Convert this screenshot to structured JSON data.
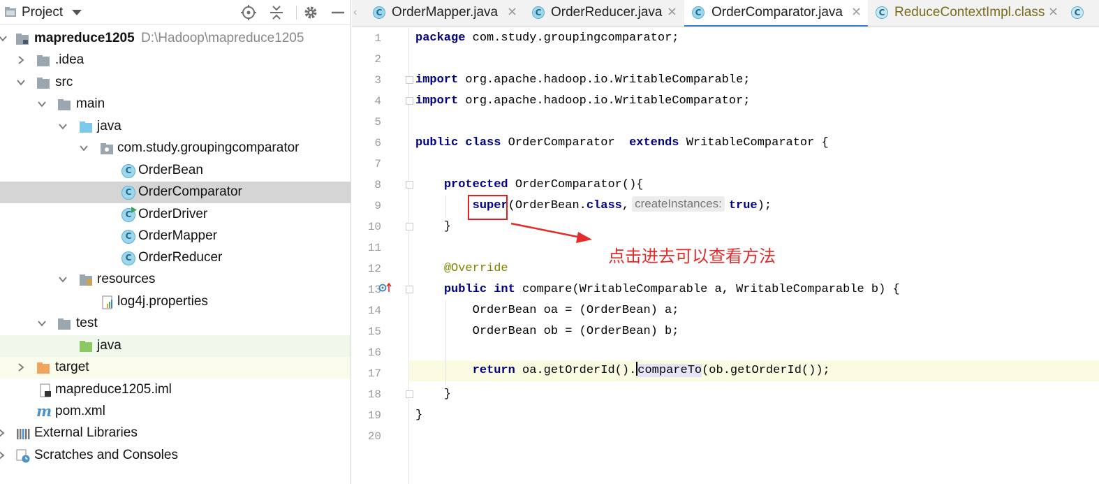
{
  "project_panel": {
    "title": "Project",
    "tree": [
      {
        "label": "mapreduce1205",
        "path": "D:\\Hadoop\\mapreduce1205",
        "icon": "module-folder-icon"
      },
      {
        "label": ".idea",
        "icon": "folder-icon"
      },
      {
        "label": "src",
        "icon": "folder-icon"
      },
      {
        "label": "main",
        "icon": "folder-icon"
      },
      {
        "label": "java",
        "icon": "source-folder-icon"
      },
      {
        "label": "com.study.groupingcomparator",
        "icon": "package-icon"
      },
      {
        "label": "OrderBean",
        "icon": "class-icon"
      },
      {
        "label": "OrderComparator",
        "icon": "class-icon"
      },
      {
        "label": "OrderDriver",
        "icon": "runnable-class-icon"
      },
      {
        "label": "OrderMapper",
        "icon": "class-icon"
      },
      {
        "label": "OrderReducer",
        "icon": "class-icon"
      },
      {
        "label": "resources",
        "icon": "resources-folder-icon"
      },
      {
        "label": "log4j.properties",
        "icon": "properties-file-icon"
      },
      {
        "label": "test",
        "icon": "folder-icon"
      },
      {
        "label": "java",
        "icon": "test-source-folder-icon"
      },
      {
        "label": "target",
        "icon": "excluded-folder-icon"
      },
      {
        "label": "mapreduce1205.iml",
        "icon": "iml-file-icon"
      },
      {
        "label": "pom.xml",
        "icon": "maven-icon"
      },
      {
        "label": "External Libraries",
        "icon": "libraries-icon"
      },
      {
        "label": "Scratches and Consoles",
        "icon": "scratches-icon"
      }
    ]
  },
  "tabs": [
    {
      "label": "OrderMapper.java",
      "active": false
    },
    {
      "label": "OrderReducer.java",
      "active": false
    },
    {
      "label": "OrderComparator.java",
      "active": true
    },
    {
      "label": "ReduceContextImpl.class",
      "active": false
    },
    {
      "label": "",
      "active": false
    }
  ],
  "editor": {
    "line_numbers": [
      "1",
      "2",
      "3",
      "4",
      "5",
      "6",
      "7",
      "8",
      "9",
      "10",
      "11",
      "12",
      "13",
      "14",
      "15",
      "16",
      "17",
      "18",
      "19",
      "20"
    ],
    "code": {
      "l1_kw": "package",
      "l1_rest": " com.study.groupingcomparator;",
      "l3_kw": "import",
      "l3_rest": " org.apache.hadoop.io.WritableComparable;",
      "l4_kw": "import",
      "l4_rest": " org.apache.hadoop.io.WritableComparator;",
      "l6_kw1": "public",
      "l6_kw2": "class",
      "l6_name": " OrderComparator  ",
      "l6_kw3": "extends",
      "l6_rest": " WritableComparator {",
      "l8_indent": "    ",
      "l8_kw": "protected",
      "l8_rest": " OrderComparator(){",
      "l9_indent": "        ",
      "l9_kw": "super",
      "l9_mid": "(OrderBean.",
      "l9_kw2": "class",
      "l9_comma": ",",
      "l9_hint": "createInstances:",
      "l9_kw3": "true",
      "l9_end": ");",
      "l10": "    }",
      "l12_indent": "    ",
      "l12_ann": "@Override",
      "l13_indent": "    ",
      "l13_kw1": "public",
      "l13_kw2": "int",
      "l13_rest": " compare(WritableComparable a, WritableComparable b) {",
      "l14": "        OrderBean oa = (OrderBean) a;",
      "l15": "        OrderBean ob = (OrderBean) b;",
      "l17_indent": "        ",
      "l17_kw": "return",
      "l17_pre": " oa.getOrderId().",
      "l17_method": "compareTo",
      "l17_post": "(ob.getOrderId());",
      "l18": "    }",
      "l19": "}"
    }
  },
  "annotation": {
    "note": "点击进去可以查看方法",
    "color": "#e52a2a"
  }
}
